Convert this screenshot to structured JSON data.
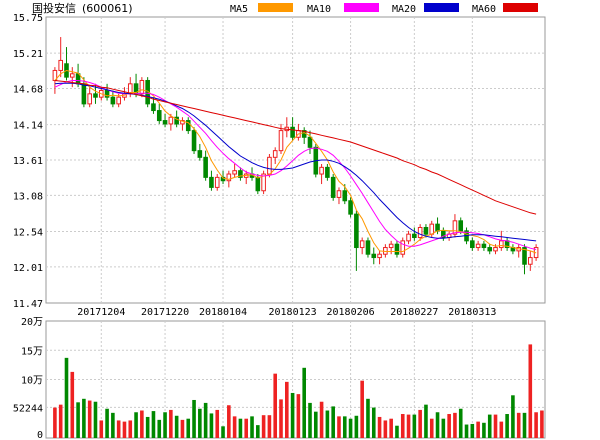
{
  "header": {
    "stock_name": "国投安信",
    "stock_code": "(600061)"
  },
  "legend": [
    {
      "label": "MA5",
      "color": "#ff9900"
    },
    {
      "label": "MA10",
      "color": "#ff00ff"
    },
    {
      "label": "MA20",
      "color": "#0000cc"
    },
    {
      "label": "MA60",
      "color": "#dd0000"
    }
  ],
  "colors": {
    "up": "#ee2222",
    "down": "#008800",
    "grid": "#cccccc",
    "axis": "#999999"
  },
  "chart_data": [
    {
      "type": "candlestick",
      "title": "",
      "y_ticks": [
        15.75,
        15.21,
        14.68,
        14.14,
        13.61,
        13.08,
        12.54,
        12.01,
        11.47
      ],
      "ylim": [
        11.47,
        15.75
      ],
      "x_tick_labels": [
        "20171204",
        "20171220",
        "20180104",
        "20180123",
        "20180206",
        "20180227",
        "20180313"
      ],
      "grid": true,
      "candles": [
        {
          "o": 14.8,
          "h": 15.0,
          "l": 14.6,
          "c": 14.95
        },
        {
          "o": 14.95,
          "h": 15.45,
          "l": 14.85,
          "c": 15.1
        },
        {
          "o": 15.05,
          "h": 15.3,
          "l": 14.8,
          "c": 14.85
        },
        {
          "o": 14.85,
          "h": 15.0,
          "l": 14.7,
          "c": 14.9
        },
        {
          "o": 14.9,
          "h": 15.05,
          "l": 14.7,
          "c": 14.75
        },
        {
          "o": 14.75,
          "h": 14.85,
          "l": 14.4,
          "c": 14.45
        },
        {
          "o": 14.45,
          "h": 14.7,
          "l": 14.4,
          "c": 14.6
        },
        {
          "o": 14.6,
          "h": 14.75,
          "l": 14.45,
          "c": 14.55
        },
        {
          "o": 14.55,
          "h": 14.7,
          "l": 14.5,
          "c": 14.65
        },
        {
          "o": 14.65,
          "h": 14.75,
          "l": 14.5,
          "c": 14.55
        },
        {
          "o": 14.55,
          "h": 14.65,
          "l": 14.4,
          "c": 14.45
        },
        {
          "o": 14.45,
          "h": 14.6,
          "l": 14.4,
          "c": 14.55
        },
        {
          "o": 14.55,
          "h": 14.7,
          "l": 14.5,
          "c": 14.6
        },
        {
          "o": 14.6,
          "h": 14.85,
          "l": 14.55,
          "c": 14.75
        },
        {
          "o": 14.75,
          "h": 14.9,
          "l": 14.55,
          "c": 14.6
        },
        {
          "o": 14.6,
          "h": 14.85,
          "l": 14.55,
          "c": 14.8
        },
        {
          "o": 14.8,
          "h": 14.85,
          "l": 14.4,
          "c": 14.45
        },
        {
          "o": 14.45,
          "h": 14.55,
          "l": 14.3,
          "c": 14.35
        },
        {
          "o": 14.35,
          "h": 14.45,
          "l": 14.15,
          "c": 14.2
        },
        {
          "o": 14.2,
          "h": 14.3,
          "l": 14.1,
          "c": 14.15
        },
        {
          "o": 14.15,
          "h": 14.3,
          "l": 14.05,
          "c": 14.25
        },
        {
          "o": 14.25,
          "h": 14.35,
          "l": 14.1,
          "c": 14.15
        },
        {
          "o": 14.15,
          "h": 14.25,
          "l": 14.05,
          "c": 14.2
        },
        {
          "o": 14.2,
          "h": 14.25,
          "l": 14.0,
          "c": 14.05
        },
        {
          "o": 14.05,
          "h": 14.1,
          "l": 13.7,
          "c": 13.75
        },
        {
          "o": 13.75,
          "h": 13.85,
          "l": 13.6,
          "c": 13.65
        },
        {
          "o": 13.65,
          "h": 13.75,
          "l": 13.3,
          "c": 13.35
        },
        {
          "o": 13.35,
          "h": 13.45,
          "l": 13.15,
          "c": 13.2
        },
        {
          "o": 13.2,
          "h": 13.4,
          "l": 13.15,
          "c": 13.35
        },
        {
          "o": 13.35,
          "h": 13.45,
          "l": 13.25,
          "c": 13.3
        },
        {
          "o": 13.3,
          "h": 13.45,
          "l": 13.2,
          "c": 13.4
        },
        {
          "o": 13.4,
          "h": 13.55,
          "l": 13.35,
          "c": 13.45
        },
        {
          "o": 13.45,
          "h": 13.5,
          "l": 13.3,
          "c": 13.35
        },
        {
          "o": 13.35,
          "h": 13.45,
          "l": 13.25,
          "c": 13.4
        },
        {
          "o": 13.4,
          "h": 13.5,
          "l": 13.3,
          "c": 13.35
        },
        {
          "o": 13.35,
          "h": 13.4,
          "l": 13.1,
          "c": 13.15
        },
        {
          "o": 13.15,
          "h": 13.45,
          "l": 13.1,
          "c": 13.4
        },
        {
          "o": 13.4,
          "h": 13.7,
          "l": 13.35,
          "c": 13.65
        },
        {
          "o": 13.65,
          "h": 13.8,
          "l": 13.55,
          "c": 13.75
        },
        {
          "o": 13.75,
          "h": 14.15,
          "l": 13.7,
          "c": 14.05
        },
        {
          "o": 14.05,
          "h": 14.25,
          "l": 13.95,
          "c": 14.1
        },
        {
          "o": 14.1,
          "h": 14.25,
          "l": 13.9,
          "c": 13.95
        },
        {
          "o": 13.95,
          "h": 14.15,
          "l": 13.9,
          "c": 14.05
        },
        {
          "o": 14.05,
          "h": 14.1,
          "l": 13.85,
          "c": 13.95
        },
        {
          "o": 13.95,
          "h": 14.05,
          "l": 13.7,
          "c": 13.8
        },
        {
          "o": 13.8,
          "h": 13.85,
          "l": 13.35,
          "c": 13.4
        },
        {
          "o": 13.4,
          "h": 13.55,
          "l": 13.25,
          "c": 13.5
        },
        {
          "o": 13.5,
          "h": 13.55,
          "l": 13.3,
          "c": 13.35
        },
        {
          "o": 13.35,
          "h": 13.4,
          "l": 13.0,
          "c": 13.05
        },
        {
          "o": 13.05,
          "h": 13.2,
          "l": 12.95,
          "c": 13.15
        },
        {
          "o": 13.15,
          "h": 13.25,
          "l": 12.95,
          "c": 13.0
        },
        {
          "o": 13.0,
          "h": 13.05,
          "l": 12.75,
          "c": 12.8
        },
        {
          "o": 12.8,
          "h": 12.85,
          "l": 11.95,
          "c": 12.3
        },
        {
          "o": 12.3,
          "h": 12.45,
          "l": 12.2,
          "c": 12.4
        },
        {
          "o": 12.4,
          "h": 12.45,
          "l": 12.15,
          "c": 12.2
        },
        {
          "o": 12.2,
          "h": 12.3,
          "l": 12.05,
          "c": 12.15
        },
        {
          "o": 12.15,
          "h": 12.25,
          "l": 12.05,
          "c": 12.2
        },
        {
          "o": 12.2,
          "h": 12.35,
          "l": 12.15,
          "c": 12.3
        },
        {
          "o": 12.3,
          "h": 12.4,
          "l": 12.2,
          "c": 12.35
        },
        {
          "o": 12.35,
          "h": 12.4,
          "l": 12.15,
          "c": 12.2
        },
        {
          "o": 12.2,
          "h": 12.45,
          "l": 12.15,
          "c": 12.4
        },
        {
          "o": 12.4,
          "h": 12.55,
          "l": 12.35,
          "c": 12.5
        },
        {
          "o": 12.5,
          "h": 12.6,
          "l": 12.4,
          "c": 12.45
        },
        {
          "o": 12.45,
          "h": 12.65,
          "l": 12.4,
          "c": 12.6
        },
        {
          "o": 12.6,
          "h": 12.65,
          "l": 12.45,
          "c": 12.5
        },
        {
          "o": 12.5,
          "h": 12.7,
          "l": 12.45,
          "c": 12.65
        },
        {
          "o": 12.65,
          "h": 12.75,
          "l": 12.5,
          "c": 12.55
        },
        {
          "o": 12.55,
          "h": 12.6,
          "l": 12.4,
          "c": 12.45
        },
        {
          "o": 12.45,
          "h": 12.55,
          "l": 12.4,
          "c": 12.5
        },
        {
          "o": 12.5,
          "h": 12.8,
          "l": 12.45,
          "c": 12.7
        },
        {
          "o": 12.7,
          "h": 12.75,
          "l": 12.5,
          "c": 12.55
        },
        {
          "o": 12.55,
          "h": 12.6,
          "l": 12.35,
          "c": 12.4
        },
        {
          "o": 12.4,
          "h": 12.45,
          "l": 12.25,
          "c": 12.3
        },
        {
          "o": 12.3,
          "h": 12.4,
          "l": 12.25,
          "c": 12.35
        },
        {
          "o": 12.35,
          "h": 12.4,
          "l": 12.25,
          "c": 12.3
        },
        {
          "o": 12.3,
          "h": 12.35,
          "l": 12.2,
          "c": 12.25
        },
        {
          "o": 12.25,
          "h": 12.35,
          "l": 12.2,
          "c": 12.3
        },
        {
          "o": 12.3,
          "h": 12.55,
          "l": 12.25,
          "c": 12.4
        },
        {
          "o": 12.4,
          "h": 12.45,
          "l": 12.25,
          "c": 12.3
        },
        {
          "o": 12.3,
          "h": 12.35,
          "l": 12.2,
          "c": 12.25
        },
        {
          "o": 12.25,
          "h": 12.35,
          "l": 12.15,
          "c": 12.3
        },
        {
          "o": 12.3,
          "h": 12.35,
          "l": 11.9,
          "c": 12.05
        },
        {
          "o": 12.05,
          "h": 12.25,
          "l": 11.95,
          "c": 12.15
        },
        {
          "o": 12.15,
          "h": 12.35,
          "l": 12.1,
          "c": 12.3
        }
      ],
      "ma_series": [
        {
          "name": "MA5",
          "values": [
            14.8,
            14.9,
            14.95,
            14.93,
            14.91,
            14.81,
            14.7,
            14.64,
            14.6,
            14.57,
            14.58,
            14.57,
            14.58,
            14.62,
            14.62,
            14.66,
            14.64,
            14.57,
            14.46,
            14.34,
            14.27,
            14.22,
            14.19,
            14.17,
            14.08,
            13.96,
            13.8,
            13.6,
            13.46,
            13.34,
            13.32,
            13.35,
            13.37,
            13.38,
            13.39,
            13.34,
            13.37,
            13.39,
            13.48,
            13.61,
            13.8,
            13.9,
            14.0,
            14.02,
            13.97,
            13.86,
            13.74,
            13.61,
            13.43,
            13.29,
            13.21,
            13.08,
            12.86,
            12.73,
            12.54,
            12.37,
            12.25,
            12.24,
            12.24,
            12.24,
            12.24,
            12.29,
            12.35,
            12.42,
            12.47,
            12.5,
            12.55,
            12.56,
            12.55,
            12.55,
            12.54,
            12.5,
            12.48,
            12.46,
            12.42,
            12.35,
            12.32,
            12.33,
            12.32,
            12.3,
            12.28,
            12.27,
            12.25,
            12.22
          ]
        },
        {
          "name": "MA10",
          "values": [
            14.7,
            14.74,
            14.78,
            14.8,
            14.8,
            14.79,
            14.77,
            14.74,
            14.7,
            14.66,
            14.63,
            14.61,
            14.6,
            14.6,
            14.6,
            14.61,
            14.61,
            14.59,
            14.55,
            14.5,
            14.45,
            14.4,
            14.34,
            14.28,
            14.19,
            14.1,
            14.01,
            13.9,
            13.8,
            13.71,
            13.63,
            13.56,
            13.49,
            13.43,
            13.4,
            13.38,
            13.37,
            13.38,
            13.4,
            13.45,
            13.52,
            13.6,
            13.68,
            13.74,
            13.78,
            13.79,
            13.77,
            13.74,
            13.68,
            13.59,
            13.49,
            13.37,
            13.24,
            13.11,
            12.97,
            12.83,
            12.69,
            12.57,
            12.48,
            12.4,
            12.35,
            12.32,
            12.32,
            12.34,
            12.37,
            12.4,
            12.43,
            12.47,
            12.5,
            12.52,
            12.53,
            12.53,
            12.52,
            12.51,
            12.49,
            12.46,
            12.43,
            12.41,
            12.4,
            12.38,
            12.35,
            12.32,
            12.29,
            12.27
          ]
        },
        {
          "name": "MA20",
          "values": [
            14.75,
            14.76,
            14.76,
            14.76,
            14.75,
            14.73,
            14.72,
            14.7,
            14.68,
            14.66,
            14.64,
            14.62,
            14.61,
            14.6,
            14.59,
            14.58,
            14.56,
            14.54,
            14.52,
            14.49,
            14.46,
            14.42,
            14.38,
            14.33,
            14.27,
            14.2,
            14.13,
            14.05,
            13.97,
            13.89,
            13.81,
            13.74,
            13.67,
            13.62,
            13.57,
            13.53,
            13.5,
            13.48,
            13.47,
            13.47,
            13.48,
            13.49,
            13.52,
            13.55,
            13.58,
            13.6,
            13.61,
            13.61,
            13.59,
            13.56,
            13.51,
            13.45,
            13.38,
            13.3,
            13.21,
            13.12,
            13.02,
            12.93,
            12.84,
            12.75,
            12.67,
            12.6,
            12.54,
            12.5,
            12.47,
            12.45,
            12.44,
            12.44,
            12.45,
            12.46,
            12.47,
            12.48,
            12.49,
            12.49,
            12.49,
            12.48,
            12.47,
            12.46,
            12.45,
            12.44,
            12.43,
            12.42,
            12.41,
            12.4
          ]
        },
        {
          "name": "MA60",
          "values": [
            14.8,
            14.79,
            14.78,
            14.77,
            14.76,
            14.75,
            14.73,
            14.72,
            14.7,
            14.69,
            14.67,
            14.65,
            14.63,
            14.61,
            14.59,
            14.57,
            14.55,
            14.52,
            14.5,
            14.48,
            14.46,
            14.44,
            14.42,
            14.4,
            14.38,
            14.36,
            14.34,
            14.32,
            14.3,
            14.28,
            14.26,
            14.24,
            14.22,
            14.2,
            14.18,
            14.16,
            14.14,
            14.12,
            14.1,
            14.08,
            14.07,
            14.06,
            14.05,
            14.04,
            14.02,
            14.0,
            13.98,
            13.96,
            13.94,
            13.92,
            13.9,
            13.88,
            13.85,
            13.82,
            13.79,
            13.76,
            13.73,
            13.7,
            13.67,
            13.64,
            13.6,
            13.57,
            13.54,
            13.5,
            13.47,
            13.43,
            13.4,
            13.36,
            13.32,
            13.28,
            13.24,
            13.2,
            13.16,
            13.12,
            13.08,
            13.04,
            13.0,
            12.97,
            12.94,
            12.91,
            12.88,
            12.85,
            12.82,
            12.8
          ]
        }
      ]
    },
    {
      "type": "bar",
      "title": "",
      "y_tick_labels": [
        "20万",
        "15万",
        "10万",
        "52244",
        "0"
      ],
      "y_tick_values": [
        200000,
        150000,
        100000,
        52244,
        0
      ],
      "ylim": [
        0,
        200000
      ],
      "values": [
        52000,
        57000,
        137000,
        113000,
        61000,
        67000,
        64000,
        62000,
        30000,
        50000,
        43000,
        30000,
        28000,
        30000,
        44000,
        47000,
        36000,
        46000,
        31000,
        44000,
        48000,
        38000,
        31000,
        33000,
        65000,
        50000,
        60000,
        42000,
        48000,
        20000,
        56000,
        37000,
        33000,
        33000,
        37000,
        22000,
        39000,
        39000,
        110000,
        66000,
        96000,
        77000,
        75000,
        120000,
        60000,
        45000,
        62000,
        47000,
        54000,
        37000,
        37000,
        33000,
        38000,
        98000,
        67000,
        52000,
        36000,
        30000,
        33000,
        21000,
        41000,
        40000,
        40000,
        48000,
        57000,
        33000,
        44000,
        33000,
        41000,
        43000,
        50000,
        23000,
        24000,
        28000,
        26000,
        40000,
        40000,
        28000,
        41000,
        73000,
        43000,
        43000,
        160000,
        44000,
        47000
      ]
    }
  ]
}
